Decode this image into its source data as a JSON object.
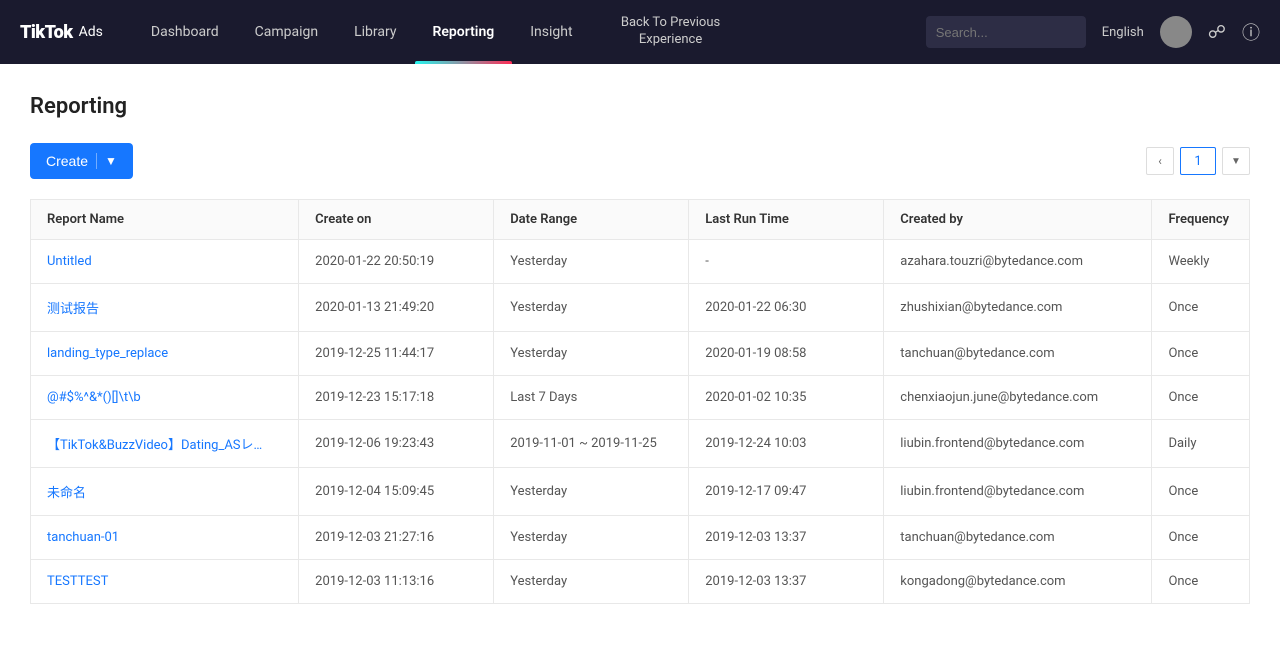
{
  "app": {
    "logo_tiktok": "TikTok",
    "logo_ads": "Ads"
  },
  "navbar": {
    "items": [
      {
        "label": "Dashboard",
        "active": false
      },
      {
        "label": "Campaign",
        "active": false
      },
      {
        "label": "Library",
        "active": false
      },
      {
        "label": "Reporting",
        "active": true
      },
      {
        "label": "Insight",
        "active": false
      }
    ],
    "back_label": "Back To Previous Experience",
    "lang": "English"
  },
  "page": {
    "title": "Reporting"
  },
  "toolbar": {
    "create_label": "Create",
    "page_number": "1"
  },
  "table": {
    "headers": [
      "Report Name",
      "Create on",
      "Date Range",
      "Last Run Time",
      "Created by",
      "Frequency"
    ],
    "rows": [
      {
        "name": "Untitled",
        "create_on": "2020-01-22 20:50:19",
        "date_range": "Yesterday",
        "last_run": "-",
        "created_by": "azahara.touzri@bytedance.com",
        "frequency": "Weekly"
      },
      {
        "name": "测试报告",
        "create_on": "2020-01-13 21:49:20",
        "date_range": "Yesterday",
        "last_run": "2020-01-22 06:30",
        "created_by": "zhushixian@bytedance.com",
        "frequency": "Once"
      },
      {
        "name": "landing_type_replace",
        "create_on": "2019-12-25 11:44:17",
        "date_range": "Yesterday",
        "last_run": "2020-01-19 08:58",
        "created_by": "tanchuan@bytedance.com",
        "frequency": "Once"
      },
      {
        "name": "@#$%^&*()[]\\t\\b",
        "create_on": "2019-12-23 15:17:18",
        "date_range": "Last 7 Days",
        "last_run": "2020-01-02 10:35",
        "created_by": "chenxiaojun.june@bytedance.com",
        "frequency": "Once"
      },
      {
        "name": "【TikTok&BuzzVideo】Dating_ASレポ...",
        "create_on": "2019-12-06 19:23:43",
        "date_range": "2019-11-01 ~ 2019-11-25",
        "last_run": "2019-12-24 10:03",
        "created_by": "liubin.frontend@bytedance.com",
        "frequency": "Daily"
      },
      {
        "name": "未命名",
        "create_on": "2019-12-04 15:09:45",
        "date_range": "Yesterday",
        "last_run": "2019-12-17 09:47",
        "created_by": "liubin.frontend@bytedance.com",
        "frequency": "Once"
      },
      {
        "name": "tanchuan-01",
        "create_on": "2019-12-03 21:27:16",
        "date_range": "Yesterday",
        "last_run": "2019-12-03 13:37",
        "created_by": "tanchuan@bytedance.com",
        "frequency": "Once"
      },
      {
        "name": "TESTTEST",
        "create_on": "2019-12-03 11:13:16",
        "date_range": "Yesterday",
        "last_run": "2019-12-03 13:37",
        "created_by": "kongadong@bytedance.com",
        "frequency": "Once"
      }
    ]
  }
}
